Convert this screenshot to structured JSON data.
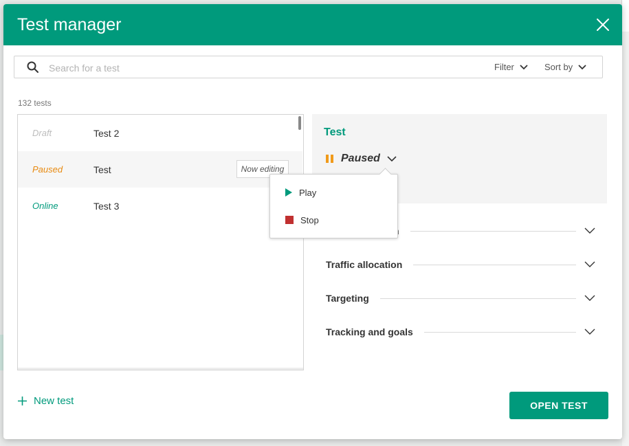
{
  "modal": {
    "title": "Test manager"
  },
  "search": {
    "placeholder": "Search for a test",
    "filter_label": "Filter",
    "sort_label": "Sort by"
  },
  "list": {
    "count_label": "132 tests",
    "rows": [
      {
        "status": "Draft",
        "name": "Test 2"
      },
      {
        "status": "Paused",
        "name": "Test",
        "badge": "Now editing"
      },
      {
        "status": "Online",
        "name": "Test 3"
      }
    ]
  },
  "panel": {
    "title": "Test",
    "status": "Paused",
    "sections": [
      "Traffic allocation",
      "Targeting",
      "Tracking and goals"
    ],
    "hidden_section_tail": "n"
  },
  "status_menu": {
    "items": [
      {
        "label": "Play"
      },
      {
        "label": "Stop"
      }
    ]
  },
  "footer": {
    "new_test_label": "New test",
    "open_test_label": "OPEN TEST"
  },
  "colors": {
    "brand": "#009a7c",
    "paused": "#e88a10",
    "draft": "#bdbdbd",
    "stop": "#c03030"
  },
  "icons": [
    "close-icon",
    "search-icon",
    "chevron-down-icon",
    "pause-icon",
    "play-icon",
    "stop-icon",
    "plus-icon"
  ]
}
